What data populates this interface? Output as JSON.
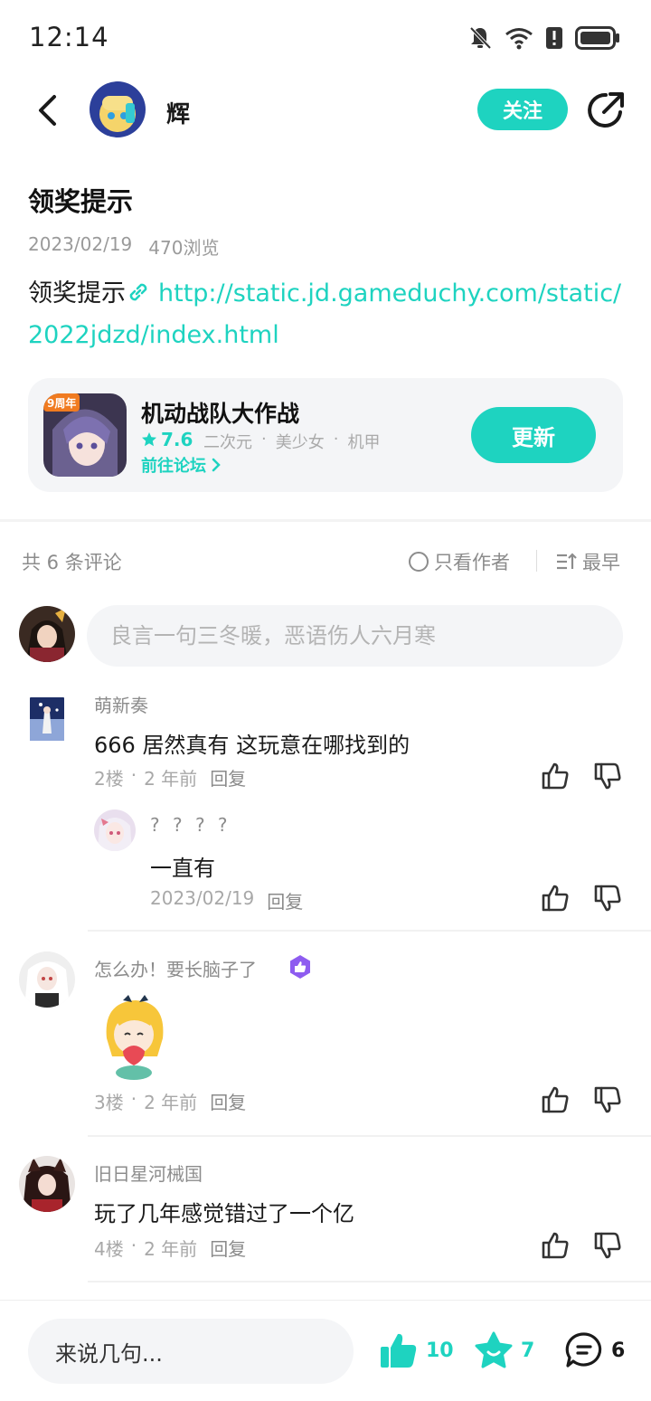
{
  "status_bar": {
    "time": "12:14"
  },
  "header": {
    "author_name": "辉",
    "follow_label": "关注"
  },
  "post": {
    "title": "领奖提示",
    "date": "2023/02/19",
    "views": "470浏览",
    "body_text": "领奖提示",
    "link": "http://static.jd.gameduchy.com/static/2022jdzd/index.html"
  },
  "game_card": {
    "name": "机动战队大作战",
    "rating": "7.6",
    "tags": [
      "二次元",
      "·",
      "美少女",
      "·",
      "机甲"
    ],
    "forum_label": "前往论坛",
    "update_label": "更新",
    "icon_badge": "9周年"
  },
  "comments_header": {
    "count_label": "共 6 条评论",
    "only_author_label": "只看作者",
    "sort_label": "最早"
  },
  "comment_input": {
    "placeholder": "良言一句三冬暖，恶语伤人六月寒"
  },
  "comments": [
    {
      "name": "萌新奏",
      "text": "666 居然真有 这玩意在哪找到的",
      "floor": "2楼",
      "time": "2 年前",
      "reply": "回复",
      "sub_reply": {
        "name": "? ? ? ?",
        "text": "一直有",
        "time": "2023/02/19",
        "reply": "回复"
      }
    },
    {
      "name": "怎么办！要长脑子了",
      "text": "",
      "floor": "3楼",
      "time": "2 年前",
      "reply": "回复"
    },
    {
      "name": "旧日星河械国",
      "text": "玩了几年感觉错过了一个亿",
      "floor": "4楼",
      "time": "2 年前",
      "reply": "回复"
    }
  ],
  "bottom_bar": {
    "input_label": "来说几句...",
    "likes": "10",
    "favorites": "7",
    "comments": "6"
  },
  "colors": {
    "accent": "#1ed3c0",
    "text_gray": "#8c8c8c",
    "card_bg": "#f4f5f7"
  },
  "icons": [
    "back-icon",
    "share-icon",
    "link-icon",
    "star-icon",
    "chevron-right-icon",
    "circle-icon",
    "sort-icon",
    "thumb-up-icon",
    "thumb-down-icon",
    "badge-icon",
    "favorite-star-icon",
    "comment-icon"
  ]
}
